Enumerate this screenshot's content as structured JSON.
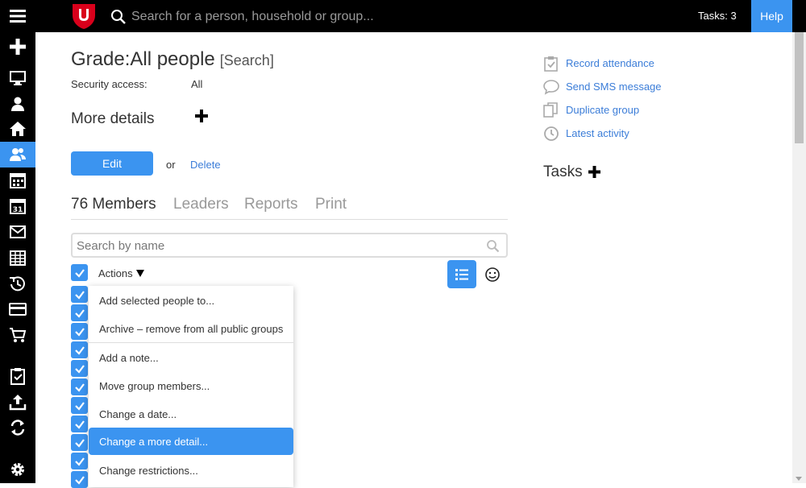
{
  "topbar": {
    "search_placeholder": "Search for a person, household or group...",
    "tasks_label": "Tasks: 3",
    "help_label": "Help",
    "brand_color": "#d9001b",
    "accent_color": "#3b94f0"
  },
  "sidebar": {
    "items": [
      {
        "icon": "plus-icon"
      },
      {
        "icon": "monitor-icon"
      },
      {
        "icon": "person-icon"
      },
      {
        "icon": "home-icon"
      },
      {
        "icon": "people-icon",
        "active": true
      },
      {
        "icon": "calendar-icon"
      },
      {
        "icon": "date-icon"
      },
      {
        "icon": "mail-icon"
      },
      {
        "icon": "grid-icon"
      },
      {
        "icon": "history-icon"
      },
      {
        "icon": "card-icon"
      },
      {
        "icon": "cart-icon"
      },
      {
        "icon": "clipboard-icon"
      },
      {
        "icon": "upload-icon"
      },
      {
        "icon": "sync-icon"
      },
      {
        "icon": "gear-icon"
      }
    ]
  },
  "group": {
    "title": "Grade:All people",
    "search_link": "[Search]",
    "security_label": "Security access:",
    "security_value": "All",
    "more_details": "More details",
    "edit_label": "Edit",
    "or_text": "or",
    "delete_label": "Delete"
  },
  "tabs": [
    "76 Members",
    "Leaders",
    "Reports",
    "Print"
  ],
  "members": {
    "search_placeholder": "Search by name",
    "actions_label": "Actions"
  },
  "actions_menu": [
    "Add selected people to...",
    "Archive – remove from all public groups",
    "Add a note...",
    "Move group members...",
    "Change a date...",
    "Change a more detail...",
    "Change restrictions..."
  ],
  "right_links": [
    {
      "label": "Record attendance",
      "icon": "clipboard-check-icon"
    },
    {
      "label": "Send SMS message",
      "icon": "speech-bubble-icon"
    },
    {
      "label": "Duplicate group",
      "icon": "duplicate-icon"
    },
    {
      "label": "Latest activity",
      "icon": "clock-icon"
    }
  ],
  "tasks_heading": "Tasks"
}
